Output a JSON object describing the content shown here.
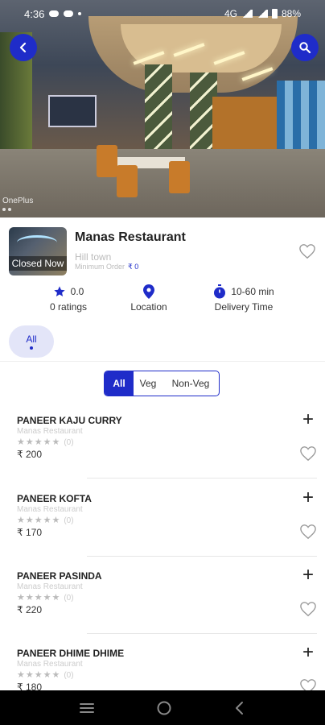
{
  "status_bar": {
    "time": "4:36",
    "network": "4G",
    "battery": "88%"
  },
  "hero": {
    "watermark": "OnePlus",
    "back_icon": "back-arrow-icon",
    "search_icon": "search-icon"
  },
  "restaurant": {
    "name": "Manas Restaurant",
    "area": "Hill town",
    "min_order_label": "Minimum Order",
    "min_order_value": "₹ 0",
    "status": "Closed Now"
  },
  "stats": {
    "rating_value": "0.0",
    "rating_label": "0 ratings",
    "location_label": "Location",
    "delivery_value": "10-60 min",
    "delivery_label": "Delivery Time"
  },
  "category_chip": "All",
  "filter": {
    "options": [
      "All",
      "Veg",
      "Non-Veg"
    ],
    "selected": "All"
  },
  "menu_items": [
    {
      "name": "PANEER KAJU CURRY",
      "restaurant": "Manas Restaurant",
      "rating_count": "(0)",
      "price": "₹ 200"
    },
    {
      "name": "PANEER KOFTA",
      "restaurant": "Manas Restaurant",
      "rating_count": "(0)",
      "price": "₹ 170"
    },
    {
      "name": "PANEER PASINDA",
      "restaurant": "Manas Restaurant",
      "rating_count": "(0)",
      "price": "₹ 220"
    },
    {
      "name": "PANEER DHIME DHIME",
      "restaurant": "Manas Restaurant",
      "rating_count": "(0)",
      "price": "₹ 180"
    }
  ],
  "colors": {
    "accent": "#1f2cc9"
  }
}
